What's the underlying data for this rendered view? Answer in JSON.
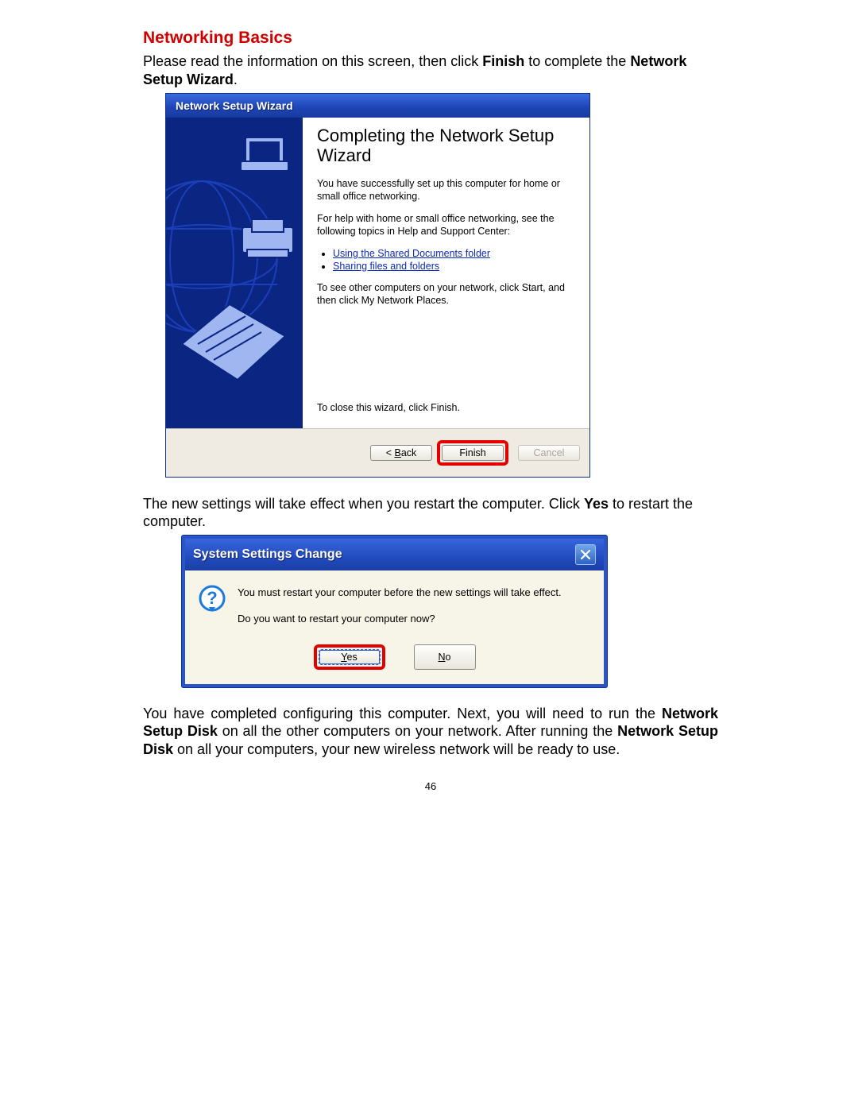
{
  "page": {
    "section_title": "Networking Basics",
    "intro_pre": "Please read the information on this screen, then click ",
    "intro_bold1": "Finish",
    "intro_mid": " to complete the ",
    "intro_bold2": "Network Setup Wizard",
    "intro_end": ".",
    "after_wizard_pre": "The new settings will take effect when you restart the computer.  Click ",
    "after_wizard_bold": "Yes",
    "after_wizard_post": " to restart the computer.",
    "final1_pre": "You have completed configuring this computer.  Next, you will need to run the ",
    "final1_bold": "Network Setup Disk",
    "final1_mid": " on all the other computers on your network.  After running the ",
    "final1_bold2": "Network Setup Disk",
    "final1_end": " on all your computers, your new wireless network will be ready to use.",
    "page_number": "46"
  },
  "wizard": {
    "title": "Network Setup Wizard",
    "heading": "Completing the Network Setup Wizard",
    "msg1": "You have successfully set up this computer for home or small office networking.",
    "msg2": "For help with home or small office networking, see the following topics in Help and Support Center:",
    "link1": "Using the Shared Documents folder",
    "link2": "Sharing files and folders",
    "msg3": "To see other computers on your network, click Start, and then click My Network Places.",
    "close_note": "To close this wizard, click Finish.",
    "btn_back_lt": "< ",
    "btn_back_u": "B",
    "btn_back_rest": "ack",
    "btn_finish": "Finish",
    "btn_cancel": "Cancel"
  },
  "restart": {
    "title": "System Settings Change",
    "line1": "You must restart your computer before the new settings will take effect.",
    "line2": "Do you want to restart your computer now?",
    "yes_u": "Y",
    "yes_rest": "es",
    "no_u": "N",
    "no_rest": "o"
  }
}
